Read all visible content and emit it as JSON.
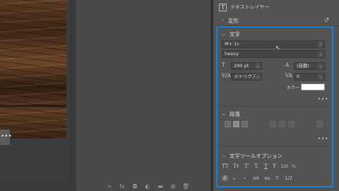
{
  "header": {
    "layer_type": "テキストレイヤー"
  },
  "transform": {
    "label": "変形"
  },
  "character": {
    "title": "文字",
    "font_family": "M+ 1c",
    "font_style": "heavy",
    "font_size": "290 pt",
    "leading": "(自動)",
    "kerning": "メトリクス",
    "tracking": "0",
    "color_label": "カラー",
    "color": "#ffffff",
    "more": "•••"
  },
  "paragraph": {
    "title": "段落",
    "more": "•••"
  },
  "type_options": {
    "title": "文字ツールオプション",
    "row1": [
      "TT",
      "Tт",
      "T'",
      "T,",
      "T",
      "Ŧ",
      "1st",
      "½"
    ],
    "row2": [
      "fi",
      "ℴ",
      "⌁",
      "ad",
      "aa",
      "T",
      "1/2"
    ]
  },
  "canvas": {
    "more_label": "•••"
  },
  "layer_toolbar": [
    "∞",
    "fx",
    "◘",
    "◐",
    "▬",
    "⊞",
    "🗑"
  ],
  "highlight_color": "#1a7fd6"
}
